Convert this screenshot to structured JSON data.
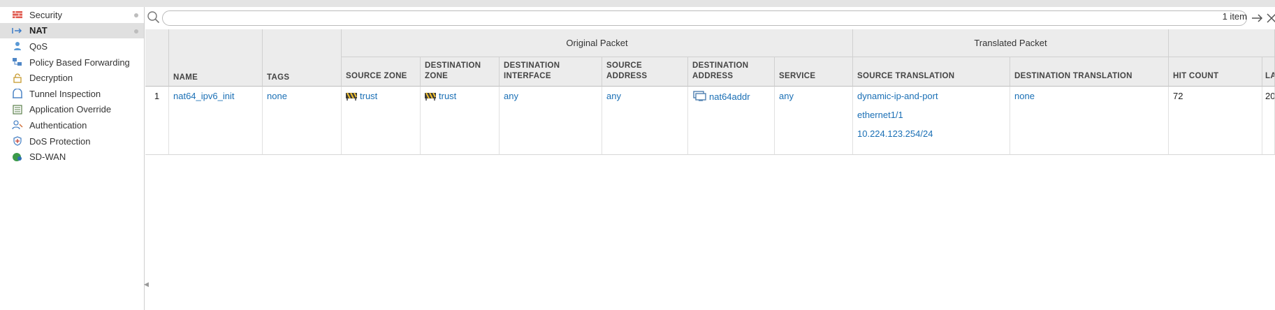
{
  "sidebar": {
    "items": [
      {
        "label": "Security",
        "icon": "security-icon",
        "dot": true
      },
      {
        "label": "NAT",
        "icon": "nat-icon",
        "dot": true,
        "active": true
      },
      {
        "label": "QoS",
        "icon": "qos-icon"
      },
      {
        "label": "Policy Based Forwarding",
        "icon": "pbf-icon"
      },
      {
        "label": "Decryption",
        "icon": "lock-icon"
      },
      {
        "label": "Tunnel Inspection",
        "icon": "tunnel-icon"
      },
      {
        "label": "Application Override",
        "icon": "app-override-icon"
      },
      {
        "label": "Authentication",
        "icon": "authentication-icon"
      },
      {
        "label": "DoS Protection",
        "icon": "shield-icon"
      },
      {
        "label": "SD-WAN",
        "icon": "sdwan-icon"
      }
    ]
  },
  "toolbar": {
    "search_placeholder": "",
    "count": "1 item"
  },
  "table": {
    "groups": {
      "original": "Original Packet",
      "translated": "Translated Packet"
    },
    "headers": {
      "name": "NAME",
      "tags": "TAGS",
      "source_zone": "SOURCE ZONE",
      "destination_zone": "DESTINATION ZONE",
      "destination_interface": "DESTINATION INTERFACE",
      "source_address": "SOURCE ADDRESS",
      "destination_address": "DESTINATION ADDRESS",
      "service": "SERVICE",
      "source_translation": "SOURCE TRANSLATION",
      "destination_translation": "DESTINATION TRANSLATION",
      "hit_count": "HIT COUNT",
      "last": "LA"
    },
    "rows": [
      {
        "index": "1",
        "name": "nat64_ipv6_init",
        "tags": "none",
        "source_zone": "trust",
        "destination_zone": "trust",
        "destination_interface": "any",
        "source_address": "any",
        "destination_address": "nat64addr",
        "service": "any",
        "source_translation": [
          "dynamic-ip-and-port",
          "ethernet1/1",
          "10.224.123.254/24"
        ],
        "destination_translation": "none",
        "hit_count": "72",
        "last": "20"
      }
    ]
  },
  "colors": {
    "link": "#1a6fb5",
    "header_bg": "#ececec",
    "active_bg": "#e0e0e0"
  }
}
